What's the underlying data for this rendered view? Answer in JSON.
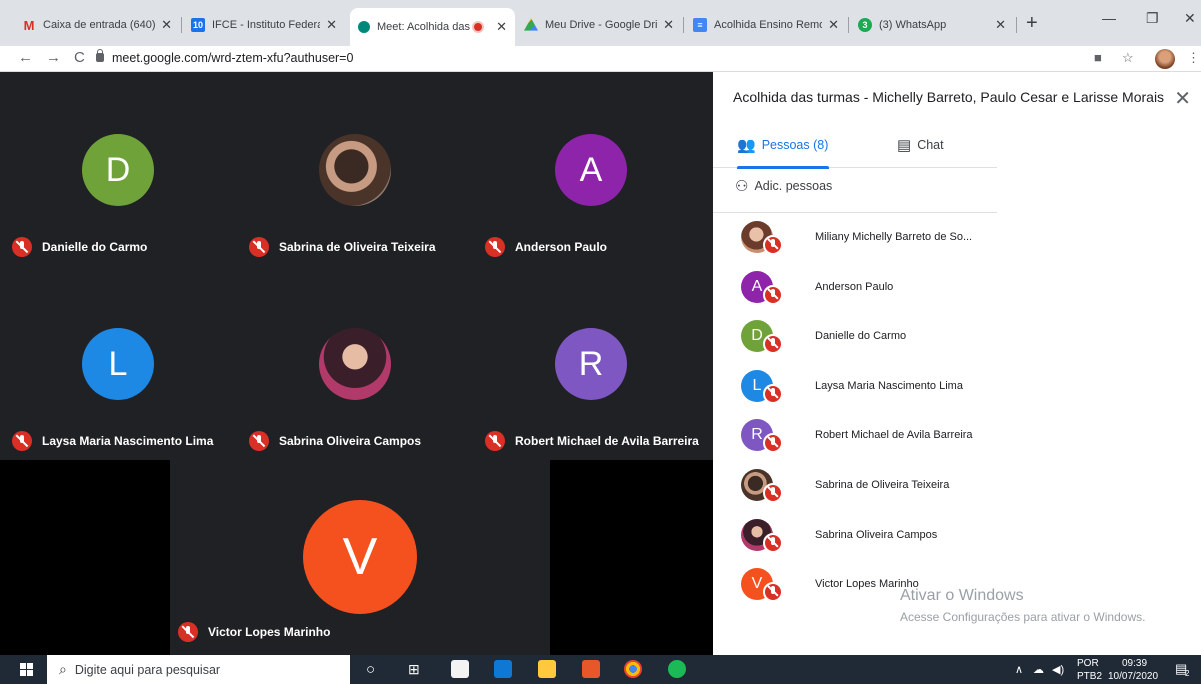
{
  "browser": {
    "tabs": [
      {
        "title": "Caixa de entrada (640)",
        "icon": "gmail-icon"
      },
      {
        "title": "IFCE - Instituto Federal",
        "icon": "ifce-icon",
        "badge": "10"
      },
      {
        "title": "Meet: Acolhida das",
        "icon": "meet-icon",
        "active": true
      },
      {
        "title": "Meu Drive - Google Dri",
        "icon": "drive-icon"
      },
      {
        "title": "Acolhida Ensino Remot",
        "icon": "docs-icon"
      },
      {
        "title": "(3) WhatsApp",
        "icon": "whatsapp-icon",
        "badge": "3"
      }
    ],
    "url": "meet.google.com/wrd-ztem-xfu?authuser=0"
  },
  "meeting": {
    "title": "Acolhida das turmas - Michelly Barreto, Paulo Cesar e Larisse Morais",
    "tiles": [
      {
        "name": "Danielle do Carmo",
        "initial": "D",
        "color": "#6fa33a"
      },
      {
        "name": "Sabrina de Oliveira Teixeira",
        "photo": true
      },
      {
        "name": "Anderson Paulo",
        "initial": "A",
        "color": "#8e24aa"
      },
      {
        "name": "Laysa Maria Nascimento Lima",
        "initial": "L",
        "color": "#1e88e5"
      },
      {
        "name": "Sabrina Oliveira Campos",
        "photo": true
      },
      {
        "name": "Robert Michael de Avila Barreira",
        "initial": "R",
        "color": "#7e57c2"
      }
    ],
    "featured": {
      "name": "Victor Lopes Marinho",
      "initial": "V",
      "color": "#f4511e"
    }
  },
  "panel": {
    "tab_people": "Pessoas (8)",
    "tab_chat": "Chat",
    "add_people": "Adic. pessoas",
    "participants": [
      {
        "name": "Miliany Michelly Barreto de So...",
        "photo": true
      },
      {
        "name": "Anderson Paulo",
        "initial": "A",
        "color": "#8e24aa"
      },
      {
        "name": "Danielle do Carmo",
        "initial": "D",
        "color": "#6fa33a"
      },
      {
        "name": "Laysa Maria Nascimento Lima",
        "initial": "L",
        "color": "#1e88e5"
      },
      {
        "name": "Robert Michael de Avila Barreira",
        "initial": "R",
        "color": "#7e57c2"
      },
      {
        "name": "Sabrina de Oliveira Teixeira",
        "photo": true
      },
      {
        "name": "Sabrina Oliveira Campos",
        "photo": true
      },
      {
        "name": "Victor Lopes Marinho",
        "initial": "V",
        "color": "#f4511e"
      }
    ]
  },
  "watermark": {
    "line1": "Ativar o Windows",
    "line2": "Acesse Configurações para ativar o Windows."
  },
  "taskbar": {
    "search_placeholder": "Digite aqui para pesquisar",
    "lang": "POR",
    "layout": "PTB2",
    "time": "09:39",
    "date": "10/07/2020",
    "notif_count": "2"
  }
}
